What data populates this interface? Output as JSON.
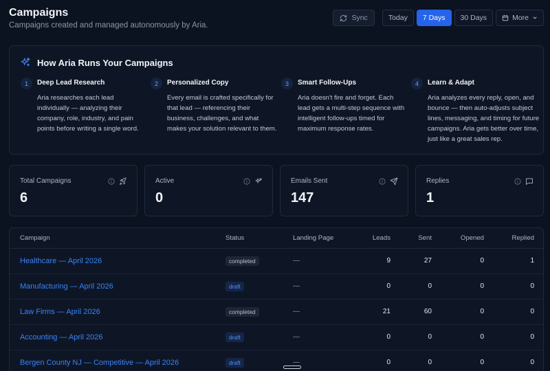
{
  "header": {
    "title": "Campaigns",
    "subtitle": "Campaigns created and managed autonomously by Aria."
  },
  "controls": {
    "sync_label": "Sync",
    "ranges": [
      "Today",
      "7 Days",
      "30 Days"
    ],
    "active_range": "7 Days",
    "more_label": "More"
  },
  "how": {
    "title": "How Aria Runs Your Campaigns",
    "steps": [
      {
        "num": "1",
        "title": "Deep Lead Research",
        "body": "Aria researches each lead individually — analyzing their company, role, industry, and pain points before writing a single word."
      },
      {
        "num": "2",
        "title": "Personalized Copy",
        "body": "Every email is crafted specifically for that lead — referencing their business, challenges, and what makes your solution relevant to them."
      },
      {
        "num": "3",
        "title": "Smart Follow-Ups",
        "body": "Aria doesn't fire and forget. Each lead gets a multi-step sequence with intelligent follow-ups timed for maximum response rates."
      },
      {
        "num": "4",
        "title": "Learn & Adapt",
        "body": "Aria analyzes every reply, open, and bounce — then auto-adjusts subject lines, messaging, and timing for future campaigns. Aria gets better over time, just like a great sales rep."
      }
    ]
  },
  "stats": [
    {
      "label": "Total Campaigns",
      "value": "6",
      "icon": "rocket-icon"
    },
    {
      "label": "Active",
      "value": "0",
      "icon": "sparkle-icon"
    },
    {
      "label": "Emails Sent",
      "value": "147",
      "icon": "send-icon"
    },
    {
      "label": "Replies",
      "value": "1",
      "icon": "chat-icon"
    }
  ],
  "table": {
    "columns": [
      "Campaign",
      "Status",
      "Landing Page",
      "Leads",
      "Sent",
      "Opened",
      "Replied"
    ],
    "rows": [
      {
        "campaign": "Healthcare — April 2026",
        "status": "completed",
        "landing": "—",
        "leads": "9",
        "sent": "27",
        "opened": "0",
        "replied": "1"
      },
      {
        "campaign": "Manufacturing — April 2026",
        "status": "draft",
        "landing": "—",
        "leads": "0",
        "sent": "0",
        "opened": "0",
        "replied": "0"
      },
      {
        "campaign": "Law Firms — April 2026",
        "status": "completed",
        "landing": "—",
        "leads": "21",
        "sent": "60",
        "opened": "0",
        "replied": "0"
      },
      {
        "campaign": "Accounting — April 2026",
        "status": "draft",
        "landing": "—",
        "leads": "0",
        "sent": "0",
        "opened": "0",
        "replied": "0"
      },
      {
        "campaign": "Bergen County NJ — Competitive — April 2026",
        "status": "draft",
        "landing": "—",
        "leads": "0",
        "sent": "0",
        "opened": "0",
        "replied": "0"
      }
    ]
  },
  "colors": {
    "background": "#0b1220",
    "panel": "#0e1626",
    "accent": "#2563eb",
    "link": "#3b82f6"
  }
}
